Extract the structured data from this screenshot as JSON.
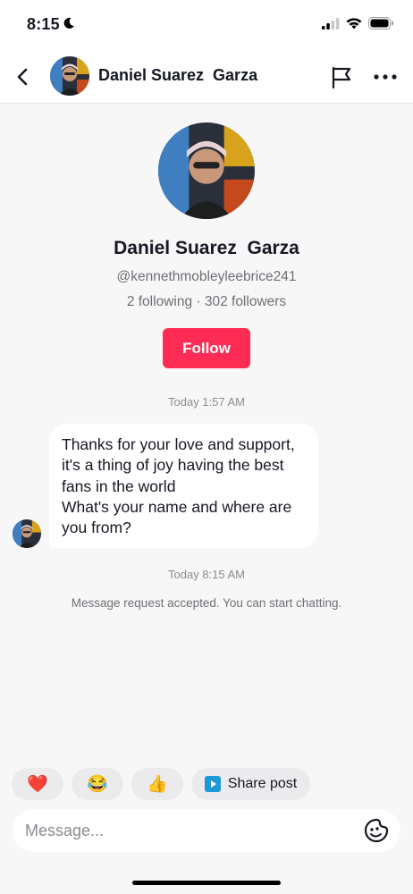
{
  "status_bar": {
    "time": "8:15"
  },
  "header": {
    "title": "Daniel Suarez  Garza",
    "icons": [
      "back-arrow-icon",
      "flag-icon",
      "more-icon"
    ]
  },
  "profile": {
    "name": "Daniel Suarez  Garza",
    "handle": "@kennethmobleyleebrice241",
    "stats": "2 following · 302 followers",
    "follow_label": "Follow"
  },
  "chat": {
    "timestamp_1": "Today 1:57 AM",
    "message_1": "Thanks for your love and support,\n it's a thing of joy having the best fans in the world\nWhat's your name and where are you from?",
    "timestamp_2": "Today 8:15 AM",
    "system_note": "Message request accepted. You can start chatting."
  },
  "quick_replies": {
    "emojis": [
      "❤️",
      "😂",
      "👍"
    ],
    "share_label": "Share post"
  },
  "composer": {
    "placeholder": "Message..."
  },
  "colors": {
    "accent": "#fe2c55",
    "background": "#f7f7f8",
    "bubble": "#ffffff"
  }
}
